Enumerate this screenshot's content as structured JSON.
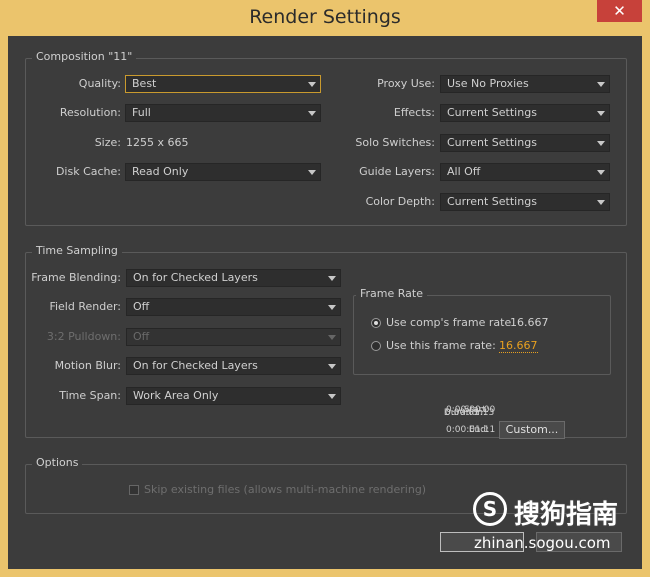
{
  "window": {
    "title": "Render Settings",
    "close_glyph": "✕"
  },
  "composition": {
    "legend": "Composition \"11\"",
    "quality_label": "Quality:",
    "quality_value": "Best",
    "resolution_label": "Resolution:",
    "resolution_value": "Full",
    "size_label": "Size:",
    "size_value": "1255 x 665",
    "disk_cache_label": "Disk Cache:",
    "disk_cache_value": "Read Only",
    "proxy_use_label": "Proxy Use:",
    "proxy_use_value": "Use No Proxies",
    "effects_label": "Effects:",
    "effects_value": "Current Settings",
    "solo_switches_label": "Solo Switches:",
    "solo_switches_value": "Current Settings",
    "guide_layers_label": "Guide Layers:",
    "guide_layers_value": "All Off",
    "color_depth_label": "Color Depth:",
    "color_depth_value": "Current Settings"
  },
  "time_sampling": {
    "legend": "Time Sampling",
    "frame_blending_label": "Frame Blending:",
    "frame_blending_value": "On for Checked Layers",
    "field_render_label": "Field Render:",
    "field_render_value": "Off",
    "pulldown_label": "3:2 Pulldown:",
    "pulldown_value": "Off",
    "motion_blur_label": "Motion Blur:",
    "motion_blur_value": "On for Checked Layers",
    "time_span_label": "Time Span:",
    "time_span_value": "Work Area Only",
    "frame_rate": {
      "legend": "Frame Rate",
      "use_comp_label": "Use comp's frame rate",
      "use_comp_value": "16.667",
      "use_this_label": "Use this frame rate:",
      "use_this_value": "16.667"
    },
    "start_label": "Start:",
    "start_value": "0:00:00:00",
    "end_label": "End:",
    "end_value": "0:00:01:11",
    "duration_label": "Duration:",
    "duration_value": "0:00:01:13",
    "custom_button": "Custom..."
  },
  "options": {
    "legend": "Options",
    "skip_existing_label": "Skip existing files (allows multi-machine rendering)"
  },
  "watermark": {
    "logo_letter": "S",
    "brand_text": "搜狗指南",
    "url_text": "zhinan.sogou.com"
  }
}
